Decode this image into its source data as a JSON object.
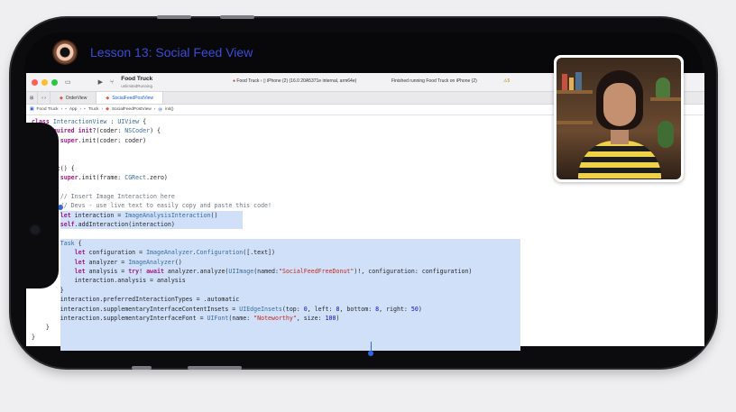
{
  "lesson": {
    "title": "Lesson 13: Social Feed View"
  },
  "toolbar": {
    "scheme_name": "Food Truck",
    "scheme_sub": "unlimitedRunning",
    "destination_app": "Food Truck",
    "destination_device": "iPhone (2) (16.0 20A5371e internal, arm64e)",
    "status": "Finished running Food Truck on iPhone (2)",
    "warning_count": "5",
    "colors": {
      "close": "#ff5f57",
      "minimize": "#febc2e",
      "zoom": "#28c840",
      "accent": "#1b5ad6"
    }
  },
  "tabs": [
    {
      "label": "OrderView"
    },
    {
      "label": "SocialFeedPostView"
    }
  ],
  "jumpbar": [
    "Food Truck",
    "App",
    "Truck",
    "SocialFeedPostView",
    "init()"
  ],
  "code": {
    "l1": "class InteractionView : UIView {",
    "l2": "    required init?(coder: NSCoder) {",
    "l3": "        super.init(coder: coder)",
    "l4": "    }",
    "l5": "",
    "l6": "    init() {",
    "l7": "        super.init(frame: CGRect.zero)",
    "l8": "",
    "l9": "        // Insert Image Interaction here",
    "l10": "        // Devs - use live text to easily copy and paste this code!",
    "l11": "        let interaction = ImageAnalysisInteraction()",
    "l12": "        self.addInteraction(interaction)",
    "l13": "",
    "l14": "        Task {",
    "l15": "            let configuration = ImageAnalyzer.Configuration([.text])",
    "l16": "            let analyzer = ImageAnalyzer()",
    "l17": "            let analysis = try! await analyzer.analyze(UIImage(named:\"SocialFeedFreeDonut\")!, configuration: configuration)",
    "l18": "            interaction.analysis = analysis",
    "l19": "        }",
    "l20": "        interaction.preferredInteractionTypes = .automatic",
    "l21": "        interaction.supplementaryInterfaceContentInsets = UIEdgeInsets(top: 0, left: 8, bottom: 8, right: 50)",
    "l22": "        interaction.supplementaryInterfaceFont = UIFont(name: \"Noteworthy\", size: 100)",
    "l23": "    }",
    "l24": "}"
  }
}
